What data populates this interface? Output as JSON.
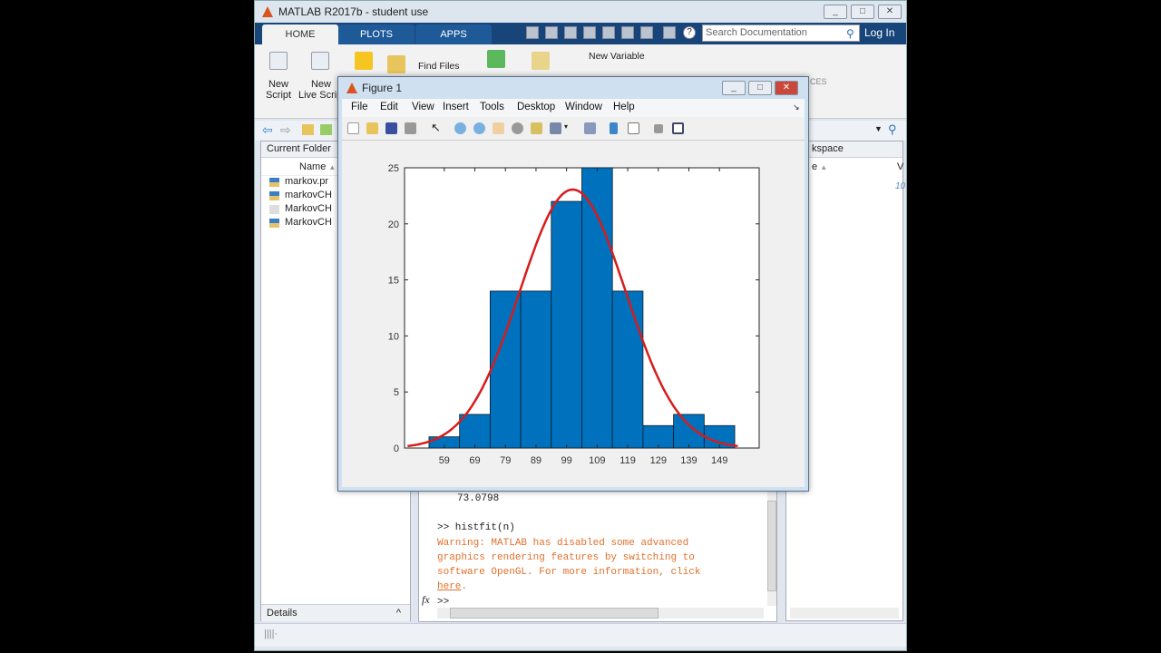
{
  "window": {
    "title": "MATLAB R2017b - student use",
    "controls": [
      "minimize",
      "maximize",
      "close"
    ]
  },
  "tabs": [
    {
      "label": "HOME",
      "active": true
    },
    {
      "label": "PLOTS"
    },
    {
      "label": "APPS"
    }
  ],
  "search": {
    "placeholder": "Search Documentation"
  },
  "login_label": "Log In",
  "ribbon": {
    "new_script": [
      "New",
      "Script"
    ],
    "new_live_script": [
      "New",
      "Live Script"
    ],
    "find_files": "Find Files",
    "new_variable": "New Variable",
    "resources_partial": "CES"
  },
  "current_folder": {
    "title": "Current Folder",
    "column": "Name",
    "files": [
      "markov.pr",
      "markovCH",
      "MarkovCH",
      "MarkovCH"
    ]
  },
  "details_label": "Details",
  "workspace": {
    "title_partial": "kspace",
    "column_partial": "e",
    "col2_partial": "V",
    "value_partial": "10"
  },
  "command_window": {
    "lines": [
      "73.0798",
      "",
      ">> histfit(n)"
    ],
    "warning": [
      "Warning: MATLAB has disabled some advanced",
      "graphics rendering features by switching to",
      "software OpenGL. For more information, click"
    ],
    "link": "here",
    "link_suffix": ".",
    "prompt": ">>",
    "fx": "fx"
  },
  "figure": {
    "title": "Figure 1",
    "menu": [
      "File",
      "Edit",
      "View",
      "Insert",
      "Tools",
      "Desktop",
      "Window",
      "Help"
    ]
  },
  "colors": {
    "bar": "#0072bd",
    "fit": "#d81b1b",
    "warning": "#e2702a",
    "tabbar": "#17457a"
  },
  "chart_data": {
    "type": "bar",
    "categories": [
      "59",
      "69",
      "79",
      "89",
      "99",
      "109",
      "119",
      "129",
      "139",
      "149"
    ],
    "x": [
      59,
      69,
      79,
      89,
      99,
      109,
      119,
      129,
      139,
      149
    ],
    "values": [
      1,
      3,
      14,
      14,
      22,
      25,
      14,
      2,
      3,
      2
    ],
    "bin_width": 10,
    "yticks": [
      "0",
      "5",
      "10",
      "15",
      "20",
      "25"
    ],
    "xlim": [
      46,
      162
    ],
    "ylim": [
      0,
      25
    ],
    "grid": false,
    "fit": {
      "type": "normal",
      "mu": 101,
      "sigma": 17.3,
      "range": [
        47,
        155
      ]
    }
  }
}
